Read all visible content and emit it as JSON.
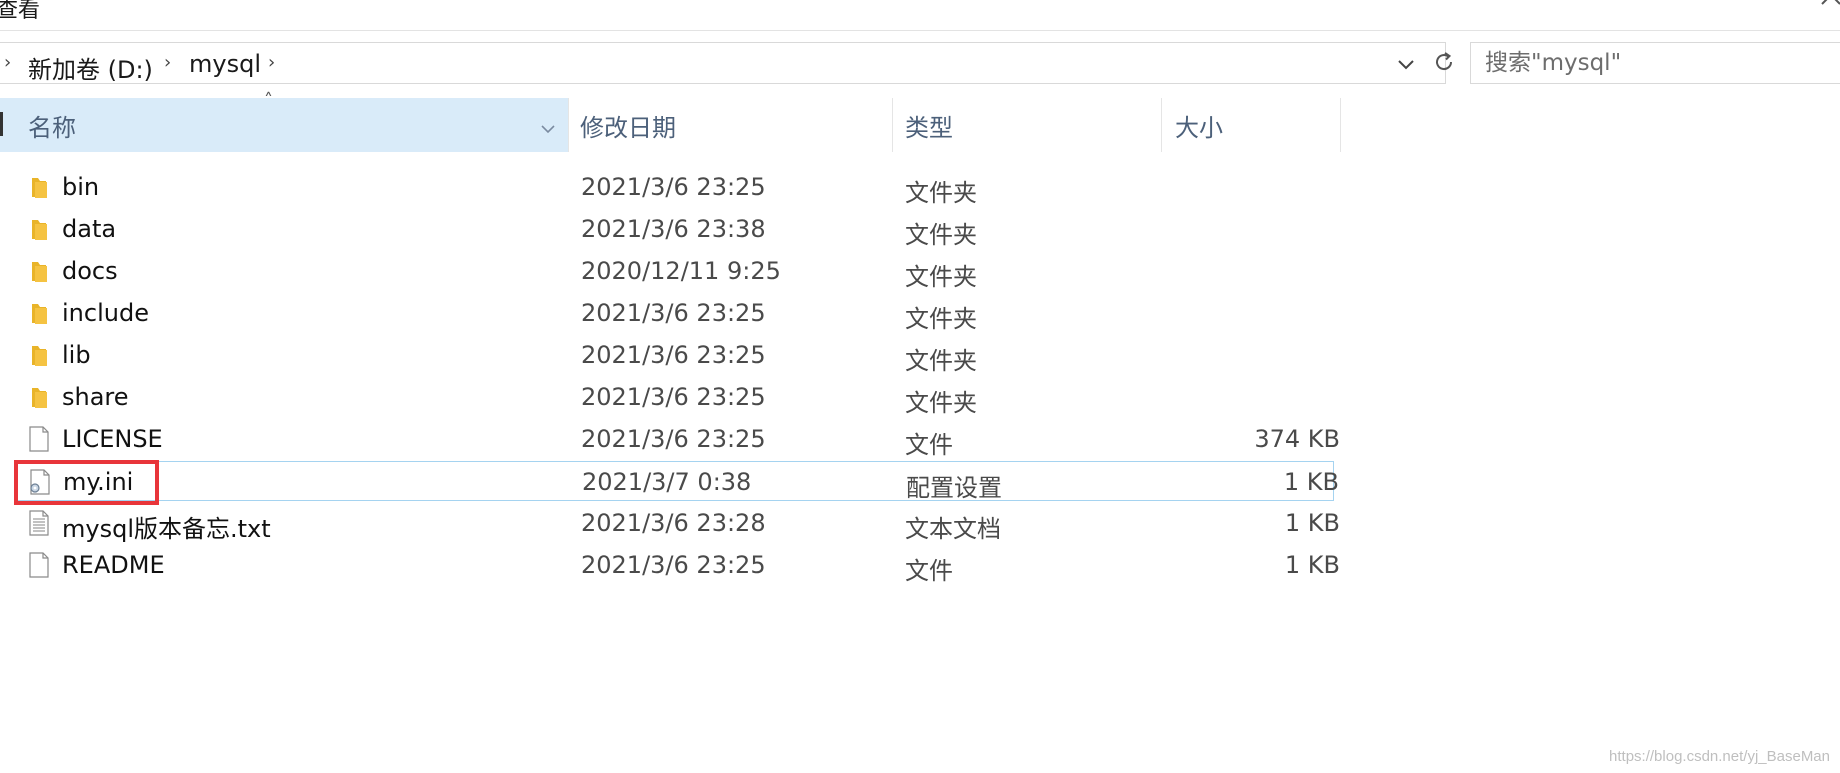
{
  "ribbon": {
    "tab_label": "查看"
  },
  "address_bar": {
    "breadcrumbs": [
      {
        "label": "新加卷 (D:)"
      },
      {
        "label": "mysql"
      }
    ]
  },
  "search": {
    "placeholder": "搜索\"mysql\""
  },
  "columns": {
    "name": "名称",
    "date_modified": "修改日期",
    "type": "类型",
    "size": "大小"
  },
  "files": [
    {
      "name": "bin",
      "date": "2021/3/6 23:25",
      "type": "文件夹",
      "size": "",
      "icon": "folder-icon"
    },
    {
      "name": "data",
      "date": "2021/3/6 23:38",
      "type": "文件夹",
      "size": "",
      "icon": "folder-icon"
    },
    {
      "name": "docs",
      "date": "2020/12/11 9:25",
      "type": "文件夹",
      "size": "",
      "icon": "folder-icon"
    },
    {
      "name": "include",
      "date": "2021/3/6 23:25",
      "type": "文件夹",
      "size": "",
      "icon": "folder-icon"
    },
    {
      "name": "lib",
      "date": "2021/3/6 23:25",
      "type": "文件夹",
      "size": "",
      "icon": "folder-icon"
    },
    {
      "name": "share",
      "date": "2021/3/6 23:25",
      "type": "文件夹",
      "size": "",
      "icon": "folder-icon"
    },
    {
      "name": "LICENSE",
      "date": "2021/3/6 23:25",
      "type": "文件",
      "size": "374 KB",
      "icon": "file-icon"
    },
    {
      "name": "my.ini",
      "date": "2021/3/7 0:38",
      "type": "配置设置",
      "size": "1 KB",
      "icon": "config-file-icon"
    },
    {
      "name": "mysql版本备忘.txt",
      "date": "2021/3/6 23:28",
      "type": "文本文档",
      "size": "1 KB",
      "icon": "text-file-icon"
    },
    {
      "name": "README",
      "date": "2021/3/6 23:25",
      "type": "文件",
      "size": "1 KB",
      "icon": "file-icon"
    }
  ],
  "colors": {
    "header_bg": "#d9ebf9",
    "header_text": "#4c607a",
    "hover_border": "#a5d3f0",
    "annotation_red": "#e8353a",
    "folder_yellow": "#f5c342"
  },
  "watermark": "https://blog.csdn.net/yj_BaseMan"
}
